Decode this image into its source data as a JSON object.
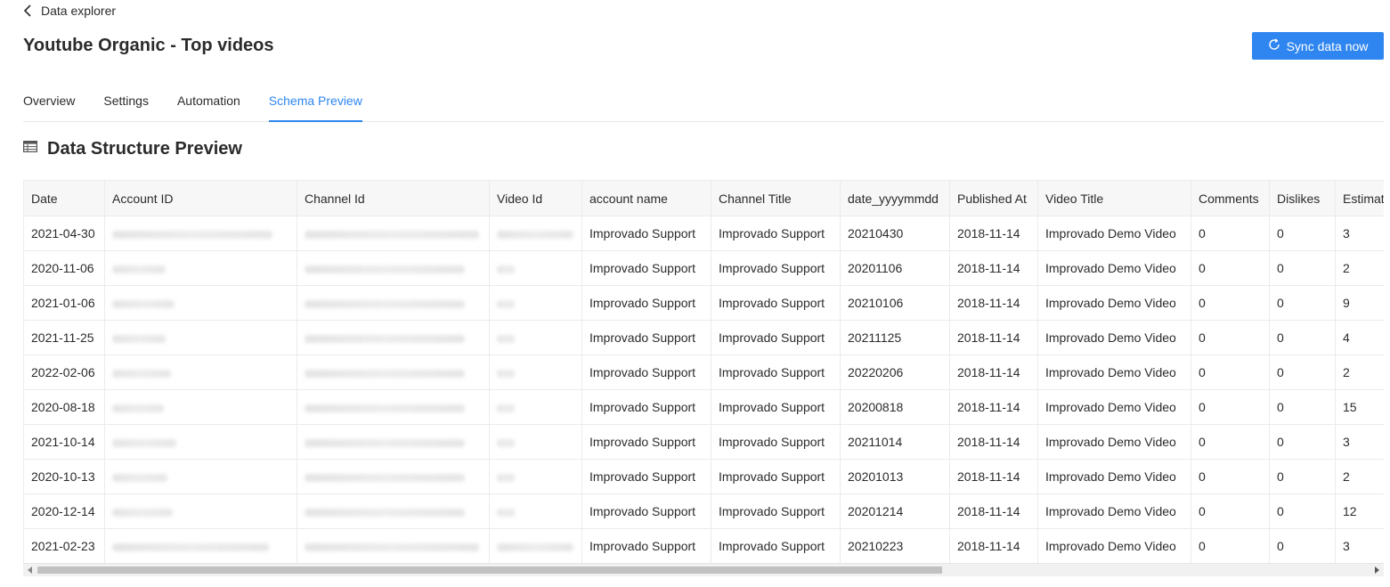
{
  "header": {
    "back_label": "Data explorer",
    "title": "Youtube Organic - Top videos",
    "sync_label": "Sync data now"
  },
  "tabs": [
    {
      "label": "Overview",
      "active": false
    },
    {
      "label": "Settings",
      "active": false
    },
    {
      "label": "Automation",
      "active": false
    },
    {
      "label": "Schema Preview",
      "active": true
    }
  ],
  "section": {
    "title": "Data Structure Preview",
    "icon": "table-icon"
  },
  "colors": {
    "accent": "#2f86f0"
  },
  "table": {
    "columns": [
      "Date",
      "Account ID",
      "Channel Id",
      "Video Id",
      "account name",
      "Channel Title",
      "date_yyyymmdd",
      "Published At",
      "Video Title",
      "Comments",
      "Dislikes",
      "Estimate"
    ],
    "redacted_columns": [
      1,
      2,
      3
    ],
    "rows": [
      [
        "2021-04-30",
        "",
        "",
        "",
        "Improvado Support",
        "Improvado Support",
        "20210430",
        "2018-11-14",
        "Improvado Demo Video",
        "0",
        "0",
        "3"
      ],
      [
        "2020-11-06",
        "",
        "",
        "",
        "Improvado Support",
        "Improvado Support",
        "20201106",
        "2018-11-14",
        "Improvado Demo Video",
        "0",
        "0",
        "2"
      ],
      [
        "2021-01-06",
        "",
        "",
        "",
        "Improvado Support",
        "Improvado Support",
        "20210106",
        "2018-11-14",
        "Improvado Demo Video",
        "0",
        "0",
        "9"
      ],
      [
        "2021-11-25",
        "",
        "",
        "",
        "Improvado Support",
        "Improvado Support",
        "20211125",
        "2018-11-14",
        "Improvado Demo Video",
        "0",
        "0",
        "4"
      ],
      [
        "2022-02-06",
        "",
        "",
        "",
        "Improvado Support",
        "Improvado Support",
        "20220206",
        "2018-11-14",
        "Improvado Demo Video",
        "0",
        "0",
        "2"
      ],
      [
        "2020-08-18",
        "",
        "",
        "",
        "Improvado Support",
        "Improvado Support",
        "20200818",
        "2018-11-14",
        "Improvado Demo Video",
        "0",
        "0",
        "15"
      ],
      [
        "2021-10-14",
        "",
        "",
        "",
        "Improvado Support",
        "Improvado Support",
        "20211014",
        "2018-11-14",
        "Improvado Demo Video",
        "0",
        "0",
        "3"
      ],
      [
        "2020-10-13",
        "",
        "",
        "",
        "Improvado Support",
        "Improvado Support",
        "20201013",
        "2018-11-14",
        "Improvado Demo Video",
        "0",
        "0",
        "2"
      ],
      [
        "2020-12-14",
        "",
        "",
        "",
        "Improvado Support",
        "Improvado Support",
        "20201214",
        "2018-11-14",
        "Improvado Demo Video",
        "0",
        "0",
        "12"
      ],
      [
        "2021-02-23",
        "",
        "",
        "",
        "Improvado Support",
        "Improvado Support",
        "20210223",
        "2018-11-14",
        "Improvado Demo Video",
        "0",
        "0",
        "3"
      ]
    ]
  }
}
